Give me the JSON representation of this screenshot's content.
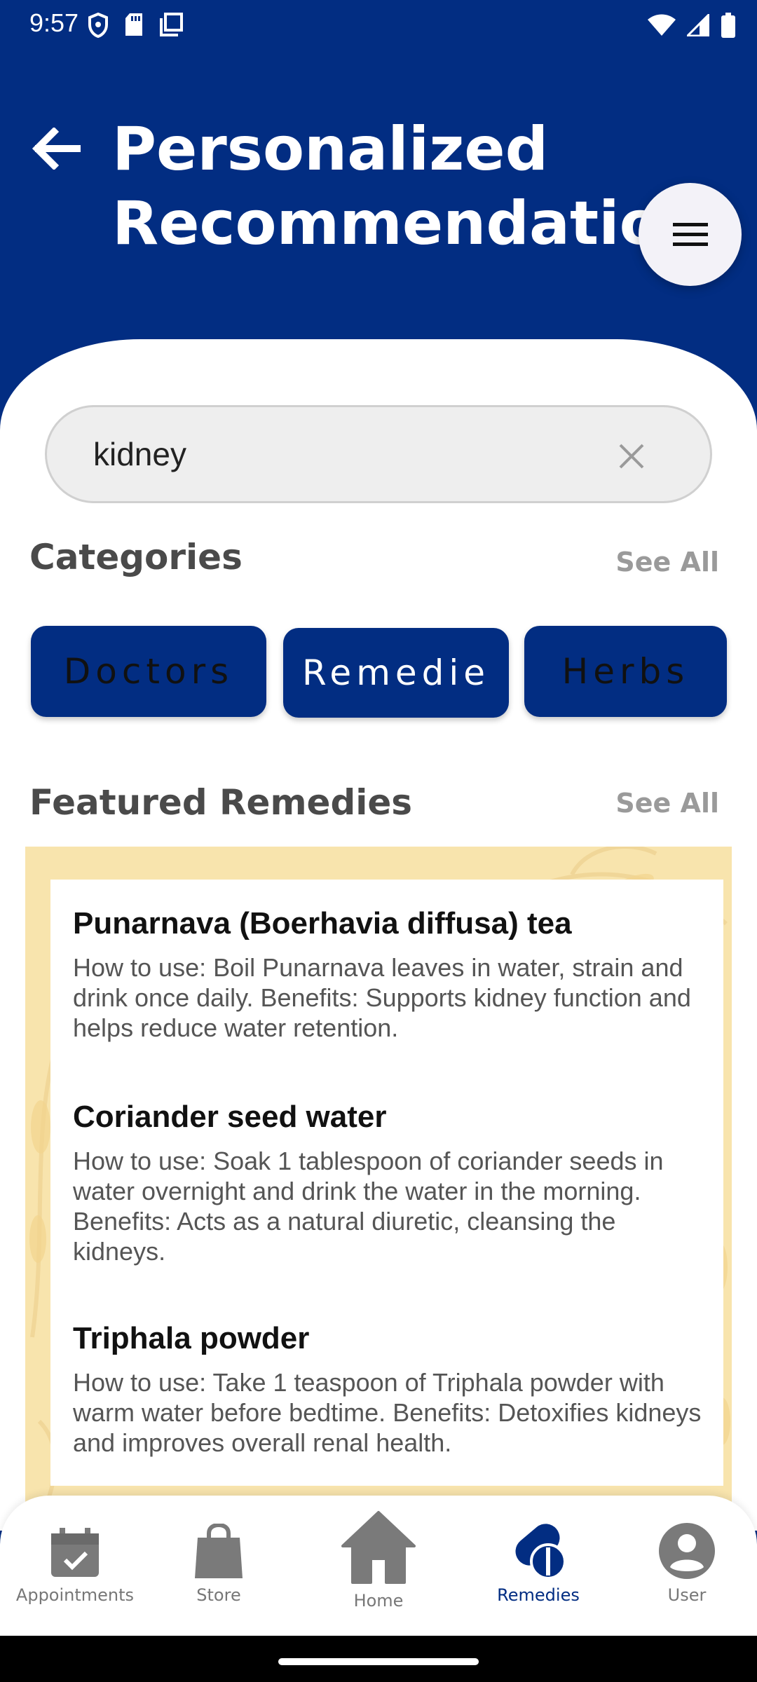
{
  "status_bar": {
    "time": "9:57",
    "left_icons": [
      "shield-icon",
      "sd-card-icon",
      "copy-icon"
    ],
    "right_icons": [
      "wifi-icon",
      "signal-icon",
      "battery-icon"
    ]
  },
  "header": {
    "title": "Personalized Recommendation",
    "back_icon": "arrow-left-icon",
    "menu_icon": "hamburger-menu-icon"
  },
  "search": {
    "value": "kidney",
    "clear_icon": "close-icon"
  },
  "categories": {
    "title": "Categories",
    "see_all": "See All",
    "items": [
      {
        "label": "Doctors"
      },
      {
        "label": "Remedie"
      },
      {
        "label": "Herbs"
      }
    ]
  },
  "featured": {
    "title": "Featured Remedies",
    "see_all": "See All",
    "remedies": [
      {
        "name": "Punarnava (Boerhavia diffusa) tea",
        "description": "How to use: Boil Punarnava leaves in water, strain and drink once daily. Benefits: Supports kidney function and helps reduce water retention."
      },
      {
        "name": "Coriander seed water",
        "description": "How to use: Soak 1 tablespoon of coriander seeds in water overnight and drink the water in the morning. Benefits: Acts as a natural diuretic, cleansing the kidneys."
      },
      {
        "name": "Triphala powder",
        "description": "How to use: Take 1 teaspoon of Triphala powder with warm water before bedtime. Benefits: Detoxifies kidneys and improves overall renal health."
      }
    ]
  },
  "bottom_nav": {
    "items": [
      {
        "label": "Appointments",
        "icon": "calendar-check-icon",
        "active": false
      },
      {
        "label": "Store",
        "icon": "shopping-bag-icon",
        "active": false
      },
      {
        "label": "Home",
        "icon": "home-icon",
        "active": false
      },
      {
        "label": "Remedies",
        "icon": "pills-icon",
        "active": true
      },
      {
        "label": "User",
        "icon": "account-circle-icon",
        "active": false
      }
    ]
  },
  "colors": {
    "primary": "#022D82",
    "feature_bg": "#F8E4AD",
    "muted_text": "#9A9A9A"
  }
}
